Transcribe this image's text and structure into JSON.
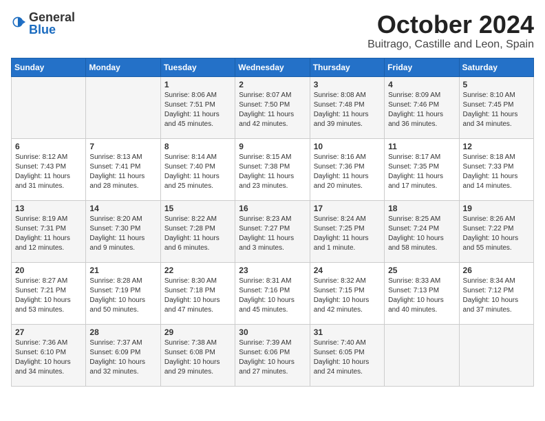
{
  "header": {
    "logo_general": "General",
    "logo_blue": "Blue",
    "month": "October 2024",
    "location": "Buitrago, Castille and Leon, Spain"
  },
  "days_of_week": [
    "Sunday",
    "Monday",
    "Tuesday",
    "Wednesday",
    "Thursday",
    "Friday",
    "Saturday"
  ],
  "weeks": [
    [
      {
        "day": "",
        "info": ""
      },
      {
        "day": "",
        "info": ""
      },
      {
        "day": "1",
        "info": "Sunrise: 8:06 AM\nSunset: 7:51 PM\nDaylight: 11 hours and 45 minutes."
      },
      {
        "day": "2",
        "info": "Sunrise: 8:07 AM\nSunset: 7:50 PM\nDaylight: 11 hours and 42 minutes."
      },
      {
        "day": "3",
        "info": "Sunrise: 8:08 AM\nSunset: 7:48 PM\nDaylight: 11 hours and 39 minutes."
      },
      {
        "day": "4",
        "info": "Sunrise: 8:09 AM\nSunset: 7:46 PM\nDaylight: 11 hours and 36 minutes."
      },
      {
        "day": "5",
        "info": "Sunrise: 8:10 AM\nSunset: 7:45 PM\nDaylight: 11 hours and 34 minutes."
      }
    ],
    [
      {
        "day": "6",
        "info": "Sunrise: 8:12 AM\nSunset: 7:43 PM\nDaylight: 11 hours and 31 minutes."
      },
      {
        "day": "7",
        "info": "Sunrise: 8:13 AM\nSunset: 7:41 PM\nDaylight: 11 hours and 28 minutes."
      },
      {
        "day": "8",
        "info": "Sunrise: 8:14 AM\nSunset: 7:40 PM\nDaylight: 11 hours and 25 minutes."
      },
      {
        "day": "9",
        "info": "Sunrise: 8:15 AM\nSunset: 7:38 PM\nDaylight: 11 hours and 23 minutes."
      },
      {
        "day": "10",
        "info": "Sunrise: 8:16 AM\nSunset: 7:36 PM\nDaylight: 11 hours and 20 minutes."
      },
      {
        "day": "11",
        "info": "Sunrise: 8:17 AM\nSunset: 7:35 PM\nDaylight: 11 hours and 17 minutes."
      },
      {
        "day": "12",
        "info": "Sunrise: 8:18 AM\nSunset: 7:33 PM\nDaylight: 11 hours and 14 minutes."
      }
    ],
    [
      {
        "day": "13",
        "info": "Sunrise: 8:19 AM\nSunset: 7:31 PM\nDaylight: 11 hours and 12 minutes."
      },
      {
        "day": "14",
        "info": "Sunrise: 8:20 AM\nSunset: 7:30 PM\nDaylight: 11 hours and 9 minutes."
      },
      {
        "day": "15",
        "info": "Sunrise: 8:22 AM\nSunset: 7:28 PM\nDaylight: 11 hours and 6 minutes."
      },
      {
        "day": "16",
        "info": "Sunrise: 8:23 AM\nSunset: 7:27 PM\nDaylight: 11 hours and 3 minutes."
      },
      {
        "day": "17",
        "info": "Sunrise: 8:24 AM\nSunset: 7:25 PM\nDaylight: 11 hours and 1 minute."
      },
      {
        "day": "18",
        "info": "Sunrise: 8:25 AM\nSunset: 7:24 PM\nDaylight: 10 hours and 58 minutes."
      },
      {
        "day": "19",
        "info": "Sunrise: 8:26 AM\nSunset: 7:22 PM\nDaylight: 10 hours and 55 minutes."
      }
    ],
    [
      {
        "day": "20",
        "info": "Sunrise: 8:27 AM\nSunset: 7:21 PM\nDaylight: 10 hours and 53 minutes."
      },
      {
        "day": "21",
        "info": "Sunrise: 8:28 AM\nSunset: 7:19 PM\nDaylight: 10 hours and 50 minutes."
      },
      {
        "day": "22",
        "info": "Sunrise: 8:30 AM\nSunset: 7:18 PM\nDaylight: 10 hours and 47 minutes."
      },
      {
        "day": "23",
        "info": "Sunrise: 8:31 AM\nSunset: 7:16 PM\nDaylight: 10 hours and 45 minutes."
      },
      {
        "day": "24",
        "info": "Sunrise: 8:32 AM\nSunset: 7:15 PM\nDaylight: 10 hours and 42 minutes."
      },
      {
        "day": "25",
        "info": "Sunrise: 8:33 AM\nSunset: 7:13 PM\nDaylight: 10 hours and 40 minutes."
      },
      {
        "day": "26",
        "info": "Sunrise: 8:34 AM\nSunset: 7:12 PM\nDaylight: 10 hours and 37 minutes."
      }
    ],
    [
      {
        "day": "27",
        "info": "Sunrise: 7:36 AM\nSunset: 6:10 PM\nDaylight: 10 hours and 34 minutes."
      },
      {
        "day": "28",
        "info": "Sunrise: 7:37 AM\nSunset: 6:09 PM\nDaylight: 10 hours and 32 minutes."
      },
      {
        "day": "29",
        "info": "Sunrise: 7:38 AM\nSunset: 6:08 PM\nDaylight: 10 hours and 29 minutes."
      },
      {
        "day": "30",
        "info": "Sunrise: 7:39 AM\nSunset: 6:06 PM\nDaylight: 10 hours and 27 minutes."
      },
      {
        "day": "31",
        "info": "Sunrise: 7:40 AM\nSunset: 6:05 PM\nDaylight: 10 hours and 24 minutes."
      },
      {
        "day": "",
        "info": ""
      },
      {
        "day": "",
        "info": ""
      }
    ]
  ]
}
